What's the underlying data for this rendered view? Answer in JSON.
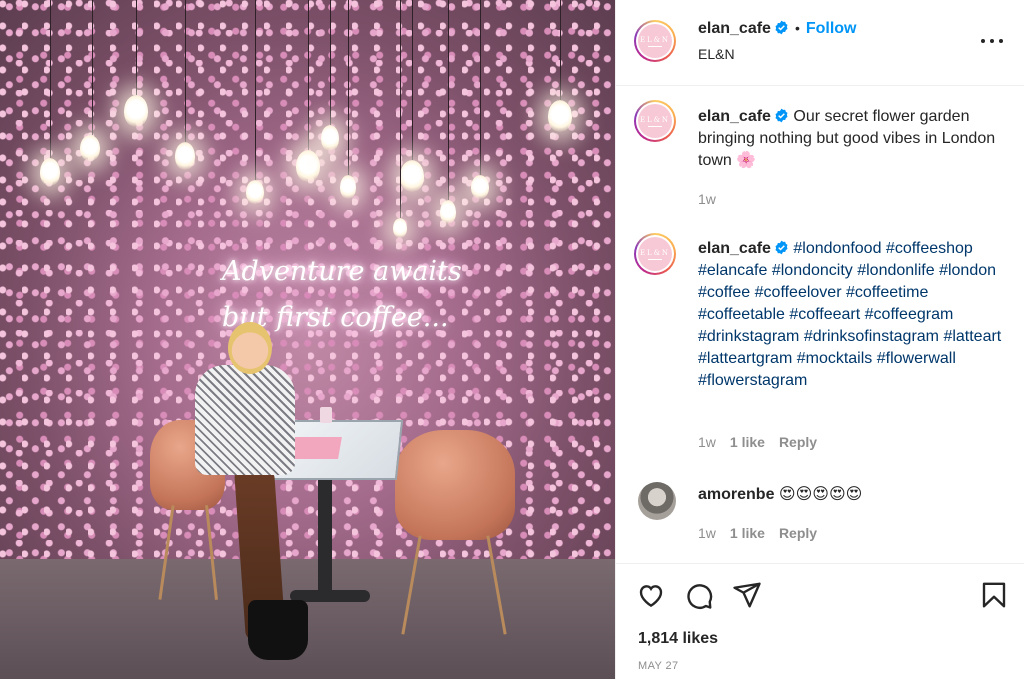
{
  "post": {
    "image_alt": "Woman seated at a marble table in front of a wall of pink flowers",
    "neon_line1": "Adventure awaits",
    "neon_line2": "but first coffee..."
  },
  "header": {
    "username": "elan_cafe",
    "separator": "•",
    "follow_label": "Follow",
    "subtitle": "EL&N",
    "avatar_text": "EL&N"
  },
  "caption": {
    "username": "elan_cafe",
    "text": "Our secret flower garden bringing nothing but good vibes in London town 🌸",
    "time": "1w"
  },
  "comments": [
    {
      "username": "elan_cafe",
      "hashtags": "#londonfood #coffeeshop #elancafe #londoncity #londonlife #london #coffee #coffeelover #coffeetime #coffeetable #coffeeart #coffeegram #drinkstagram #drinksofinstagram #latteart #latteartgram #mocktails #flowerwall #flowerstagram",
      "time": "1w",
      "likes": "1 like",
      "reply": "Reply"
    },
    {
      "username": "amorenbe",
      "text": "😍😍😍😍😍",
      "time": "1w",
      "likes": "1 like",
      "reply": "Reply"
    }
  ],
  "footer": {
    "likes": "1,814 likes",
    "date": "MAY 27"
  },
  "icons": {
    "like": "heart-icon",
    "comment": "comment-icon",
    "share": "paper-plane-icon",
    "save": "bookmark-icon",
    "more": "more-options-icon",
    "verified": "verified-badge-icon"
  },
  "colors": {
    "link": "#0095f6",
    "hashtag": "#00376b",
    "secondary_text": "#8e8e8e",
    "primary_text": "#262626"
  }
}
